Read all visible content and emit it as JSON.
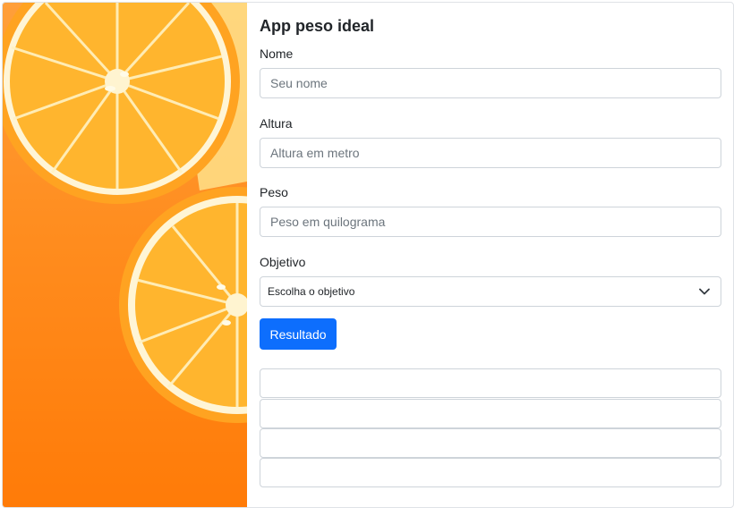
{
  "app": {
    "title": "App peso ideal"
  },
  "form": {
    "nome": {
      "label": "Nome",
      "placeholder": "Seu nome",
      "value": ""
    },
    "altura": {
      "label": "Altura",
      "placeholder": "Altura em metro",
      "value": ""
    },
    "peso": {
      "label": "Peso",
      "placeholder": "Peso em quilograma",
      "value": ""
    },
    "objetivo": {
      "label": "Objetivo",
      "selected": "Escolha o objetivo"
    },
    "submit_label": "Resultado"
  },
  "results": [
    "",
    "",
    "",
    ""
  ],
  "colors": {
    "primary": "#0d6efd",
    "orange": "#ff8d1f"
  },
  "icons": {
    "select_chevron": "chevron-down-icon"
  }
}
